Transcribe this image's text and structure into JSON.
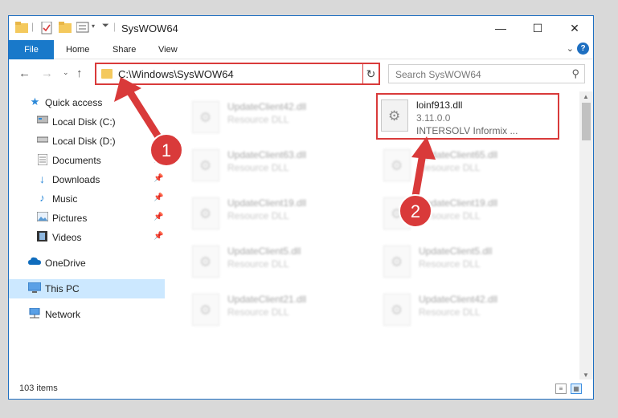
{
  "window": {
    "title": "SysWOW64"
  },
  "ribbon": {
    "tabs": [
      "File",
      "Home",
      "Share",
      "View"
    ]
  },
  "address": {
    "path": "C:\\Windows\\SysWOW64"
  },
  "search": {
    "placeholder": "Search SysWOW64"
  },
  "sidebar": {
    "items": [
      {
        "label": "Quick access",
        "icon": "star-icon"
      },
      {
        "label": "Local Disk (C:)",
        "icon": "drive-icon"
      },
      {
        "label": "Local Disk (D:)",
        "icon": "drive-icon"
      },
      {
        "label": "Documents",
        "icon": "documents-icon",
        "pinned": true
      },
      {
        "label": "Downloads",
        "icon": "download-icon",
        "pinned": true
      },
      {
        "label": "Music",
        "icon": "music-icon",
        "pinned": true
      },
      {
        "label": "Pictures",
        "icon": "pictures-icon",
        "pinned": true
      },
      {
        "label": "Videos",
        "icon": "videos-icon",
        "pinned": true
      },
      {
        "label": "OneDrive",
        "icon": "cloud-icon"
      },
      {
        "label": "This PC",
        "icon": "computer-icon",
        "selected": true
      },
      {
        "label": "Network",
        "icon": "network-icon"
      }
    ]
  },
  "files": [
    {
      "name": "UpdateClient42.dll",
      "desc": "Resource DLL"
    },
    {
      "name": "loinf913.dll",
      "version": "3.11.0.0",
      "company": "INTERSOLV Informix ...",
      "highlighted": true
    },
    {
      "name": "UpdateClient63.dll",
      "desc": "Resource DLL"
    },
    {
      "name": "UpdateClient65.dll",
      "desc": "Resource DLL"
    },
    {
      "name": "UpdateClient19.dll",
      "desc": "Resource DLL"
    },
    {
      "name": "UpdateClient19.dll",
      "desc": "Resource DLL"
    },
    {
      "name": "UpdateClient5.dll",
      "desc": "Resource DLL"
    },
    {
      "name": "UpdateClient5.dll",
      "desc": "Resource DLL"
    },
    {
      "name": "UpdateClient21.dll",
      "desc": "Resource DLL"
    },
    {
      "name": "UpdateClient42.dll",
      "desc": "Resource DLL"
    }
  ],
  "status": {
    "item_count": "103 items"
  },
  "annotations": {
    "labels": [
      "1",
      "2"
    ],
    "color": "#d93a3a"
  }
}
